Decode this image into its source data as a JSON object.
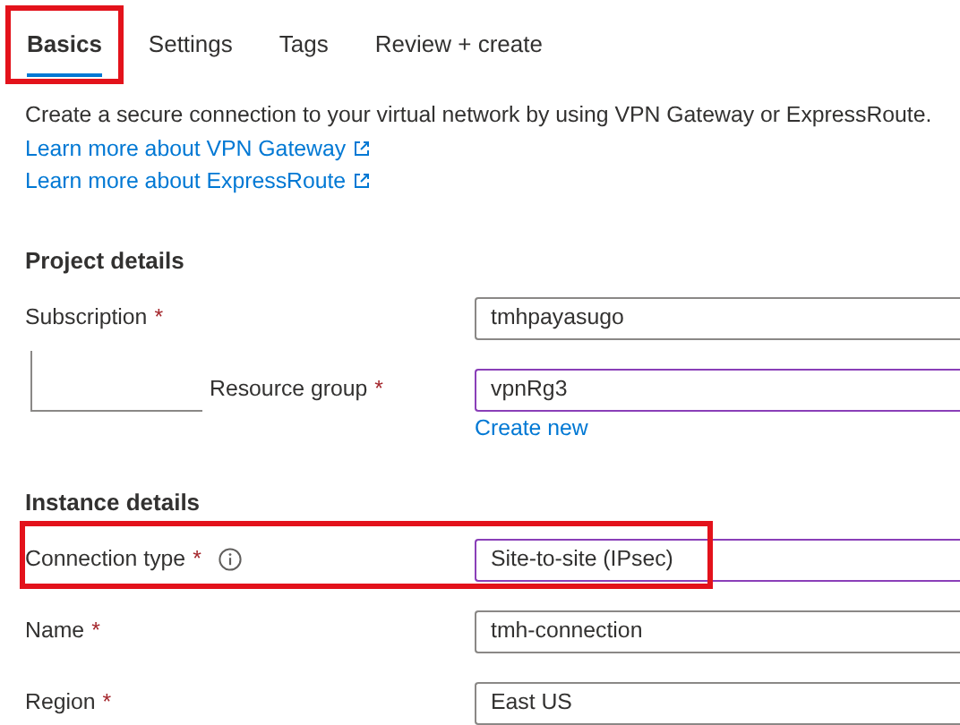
{
  "tabs": [
    {
      "label": "Basics",
      "selected": true,
      "highlighted": true
    },
    {
      "label": "Settings",
      "selected": false,
      "highlighted": false
    },
    {
      "label": "Tags",
      "selected": false,
      "highlighted": false
    },
    {
      "label": "Review + create",
      "selected": false,
      "highlighted": false
    }
  ],
  "description": "Create a secure connection to your virtual network by using VPN Gateway or ExpressRoute.",
  "links": [
    "Learn more about VPN Gateway",
    "Learn more about ExpressRoute"
  ],
  "sections": [
    {
      "title": "Project details",
      "fields": [
        {
          "label": "Subscription",
          "required_mark": "*",
          "value": "tmhpayasugo",
          "focused": false,
          "children": [
            {
              "label": "Resource group",
              "required_mark": "*",
              "value": "vpnRg3",
              "focused": true,
              "link": "Create new"
            }
          ]
        }
      ]
    },
    {
      "title": "Instance details",
      "fields": [
        {
          "label": "Connection type",
          "required_mark": "*",
          "info": true,
          "value": "Site-to-site (IPsec)",
          "focused": true,
          "highlighted": true
        },
        {
          "label": "Name",
          "required_mark": "*",
          "value": "tmh-connection",
          "focused": false
        },
        {
          "label": "Region",
          "required_mark": "*",
          "value": "East US",
          "focused": false
        }
      ]
    }
  ]
}
